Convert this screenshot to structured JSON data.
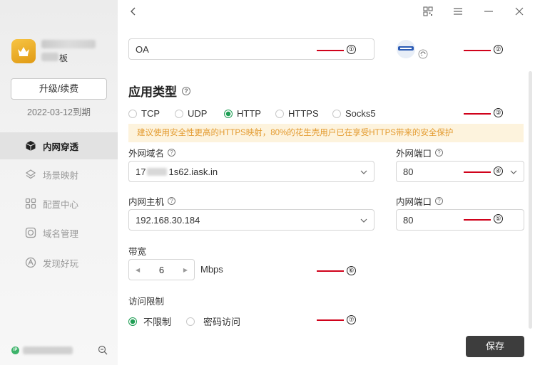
{
  "sidebar": {
    "account_plan_suffix": "板",
    "upgrade_label": "升级/续费",
    "expire_text": "2022-03-12到期",
    "items": [
      {
        "label": "内网穿透",
        "icon": "cube-icon"
      },
      {
        "label": "场景映射",
        "icon": "layers-icon"
      },
      {
        "label": "配置中心",
        "icon": "apps-icon"
      },
      {
        "label": "域名管理",
        "icon": "globe-icon"
      },
      {
        "label": "发现好玩",
        "icon": "discover-icon"
      }
    ],
    "ip_badge": "IP"
  },
  "form": {
    "name_value": "OA",
    "section_title": "应用类型",
    "protocols": [
      "TCP",
      "UDP",
      "HTTP",
      "HTTPS",
      "Socks5"
    ],
    "selected_protocol": "HTTP",
    "warning": "建议使用安全性更高的HTTPS映射，80%的花生壳用户已在享受HTTPS带来的安全保护",
    "external_domain_label": "外网域名",
    "external_domain_prefix": "17",
    "external_domain_suffix": "1s62.iask.in",
    "external_port_label": "外网端口",
    "external_port_value": "80",
    "internal_host_label": "内网主机",
    "internal_host_value": "192.168.30.184",
    "internal_port_label": "内网端口",
    "internal_port_value": "80",
    "bandwidth_label": "带宽",
    "bandwidth_value": "6",
    "bandwidth_unit": "Mbps",
    "access_label": "访问限制",
    "access_options": [
      "不限制",
      "密码访问"
    ],
    "selected_access": "不限制",
    "save_label": "保存"
  },
  "annotations": [
    "①",
    "②",
    "③",
    "④",
    "⑤",
    "⑥",
    "⑦"
  ],
  "colors": {
    "accent_green": "#1e9e54",
    "annotation_red": "#d0021b",
    "warning_text": "#e39a2e",
    "warning_bg": "#fdf3dd",
    "save_bg": "#3d3d3d"
  }
}
